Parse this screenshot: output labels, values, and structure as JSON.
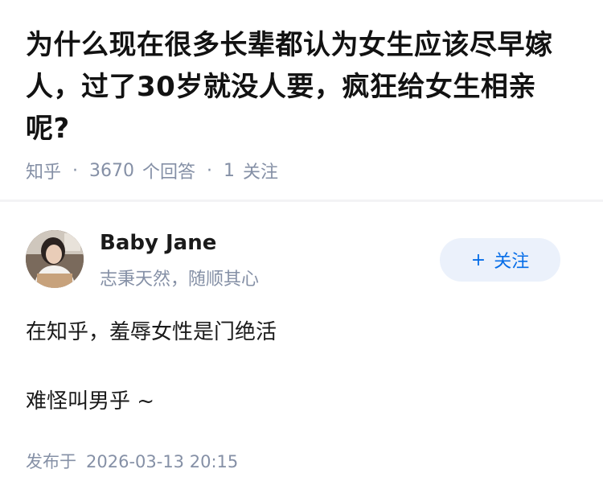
{
  "question": {
    "title": "为什么现在很多长辈都认为女生应该尽早嫁人，过了30岁就没人要，疯狂给女生相亲呢?",
    "source": "知乎",
    "separator": "·",
    "answers_count": "3670",
    "answers_label": "个回答",
    "followers_count": "1",
    "followers_label": "关注"
  },
  "author": {
    "name": "Baby Jane",
    "bio": "志秉天然，随顺其心",
    "avatar_icon": "avatar-photo-icon",
    "follow_plus": "+",
    "follow_label": "关注"
  },
  "answer": {
    "paragraphs": [
      "在知乎，羞辱女性是门绝活",
      "难怪叫男乎 ~"
    ]
  },
  "footer": {
    "published_label": "发布于",
    "published_time": "2026-03-13 20:15"
  },
  "colors": {
    "meta_gray": "#8590a6",
    "accent_blue": "#056de8",
    "follow_bg": "#ebf1fb"
  }
}
